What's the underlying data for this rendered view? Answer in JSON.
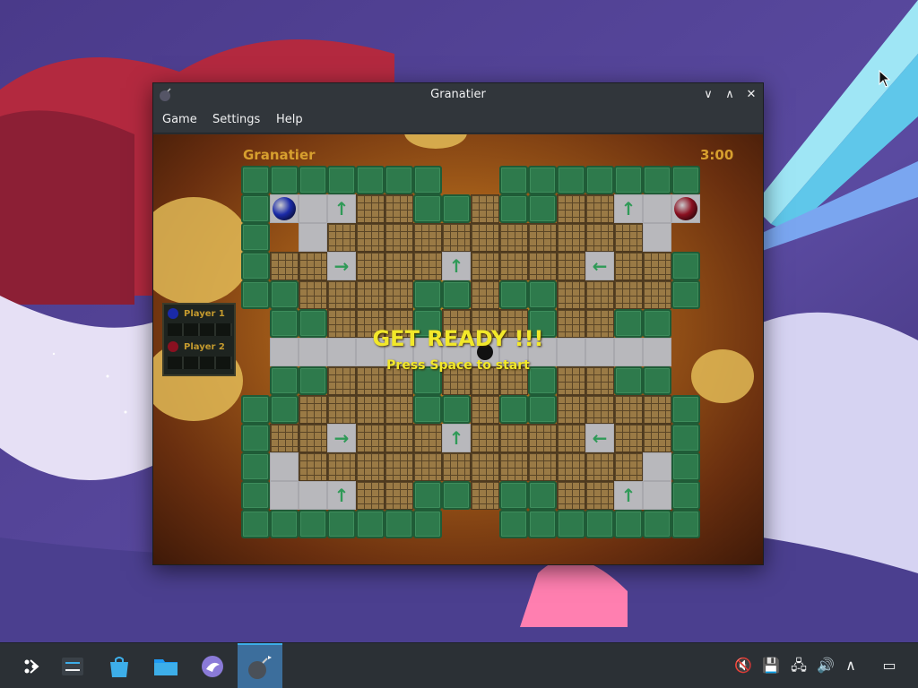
{
  "window": {
    "title": "Granatier",
    "minimize_glyph": "∨",
    "maximize_glyph": "∧",
    "close_glyph": "✕",
    "app_icon": "bomb-icon"
  },
  "menu": [
    "Game",
    "Settings",
    "Help"
  ],
  "game": {
    "arena_title": "Granatier",
    "timer": "3:00",
    "overlay_title": "GET READY !!!",
    "overlay_subtitle": "Press Space to start",
    "colors": {
      "wall": "#2e7a4c",
      "brick": "#9a7a45",
      "ground": "#b8b8bc",
      "arrow": "#2f9a57",
      "overlay_text": "#f2e82a"
    },
    "map": [
      "WWWWWWW..WWWWWWW",
      "W1GABBWWBWWBBAG2",
      "W.GBBBBBBBBBBBG.",
      "WBBRBBBABBBBLBBW",
      "WWBBBBWWBWWBBBBW",
      ".WWBBBWBBBWBBWW.",
      ".GGGGGGGGGGGGGG.",
      ".WWBBBWBBBWBBWW.",
      "WWBBBBWWBWWBBBBW",
      "WBBRBBBABBBBLBBW",
      "WGBBBBBBBBBBBBGW",
      "WGGABBWWBWWBBAGW",
      "WWWWWWW..WWWWWWW"
    ],
    "players": [
      {
        "name": "Player 1",
        "color": "#1a2aa8",
        "row": 1,
        "col": 1
      },
      {
        "name": "Player 2",
        "color": "#8a1020",
        "row": 1,
        "col": 15
      }
    ],
    "bomb": {
      "row": 6,
      "col": 8
    }
  },
  "taskbar": {
    "items": [
      {
        "name": "application-launcher",
        "icon": "launcher-icon",
        "active": false
      },
      {
        "name": "system-settings",
        "icon": "settings-icon",
        "active": false
      },
      {
        "name": "discover",
        "icon": "store-bag-icon",
        "active": false
      },
      {
        "name": "dolphin",
        "icon": "folder-icon",
        "active": false
      },
      {
        "name": "browser",
        "icon": "bird-icon",
        "active": false
      },
      {
        "name": "granatier",
        "icon": "bomb-icon",
        "active": true
      }
    ],
    "tray": [
      {
        "icon": "mute-icon",
        "glyph": "🔇"
      },
      {
        "icon": "save-icon",
        "glyph": "💾"
      },
      {
        "icon": "network-icon",
        "glyph": "🖧"
      },
      {
        "icon": "volume-icon",
        "glyph": "🔊"
      },
      {
        "icon": "expand-tray-icon",
        "glyph": "∧"
      },
      {
        "icon": "show-desktop-icon",
        "glyph": "▭"
      }
    ]
  }
}
